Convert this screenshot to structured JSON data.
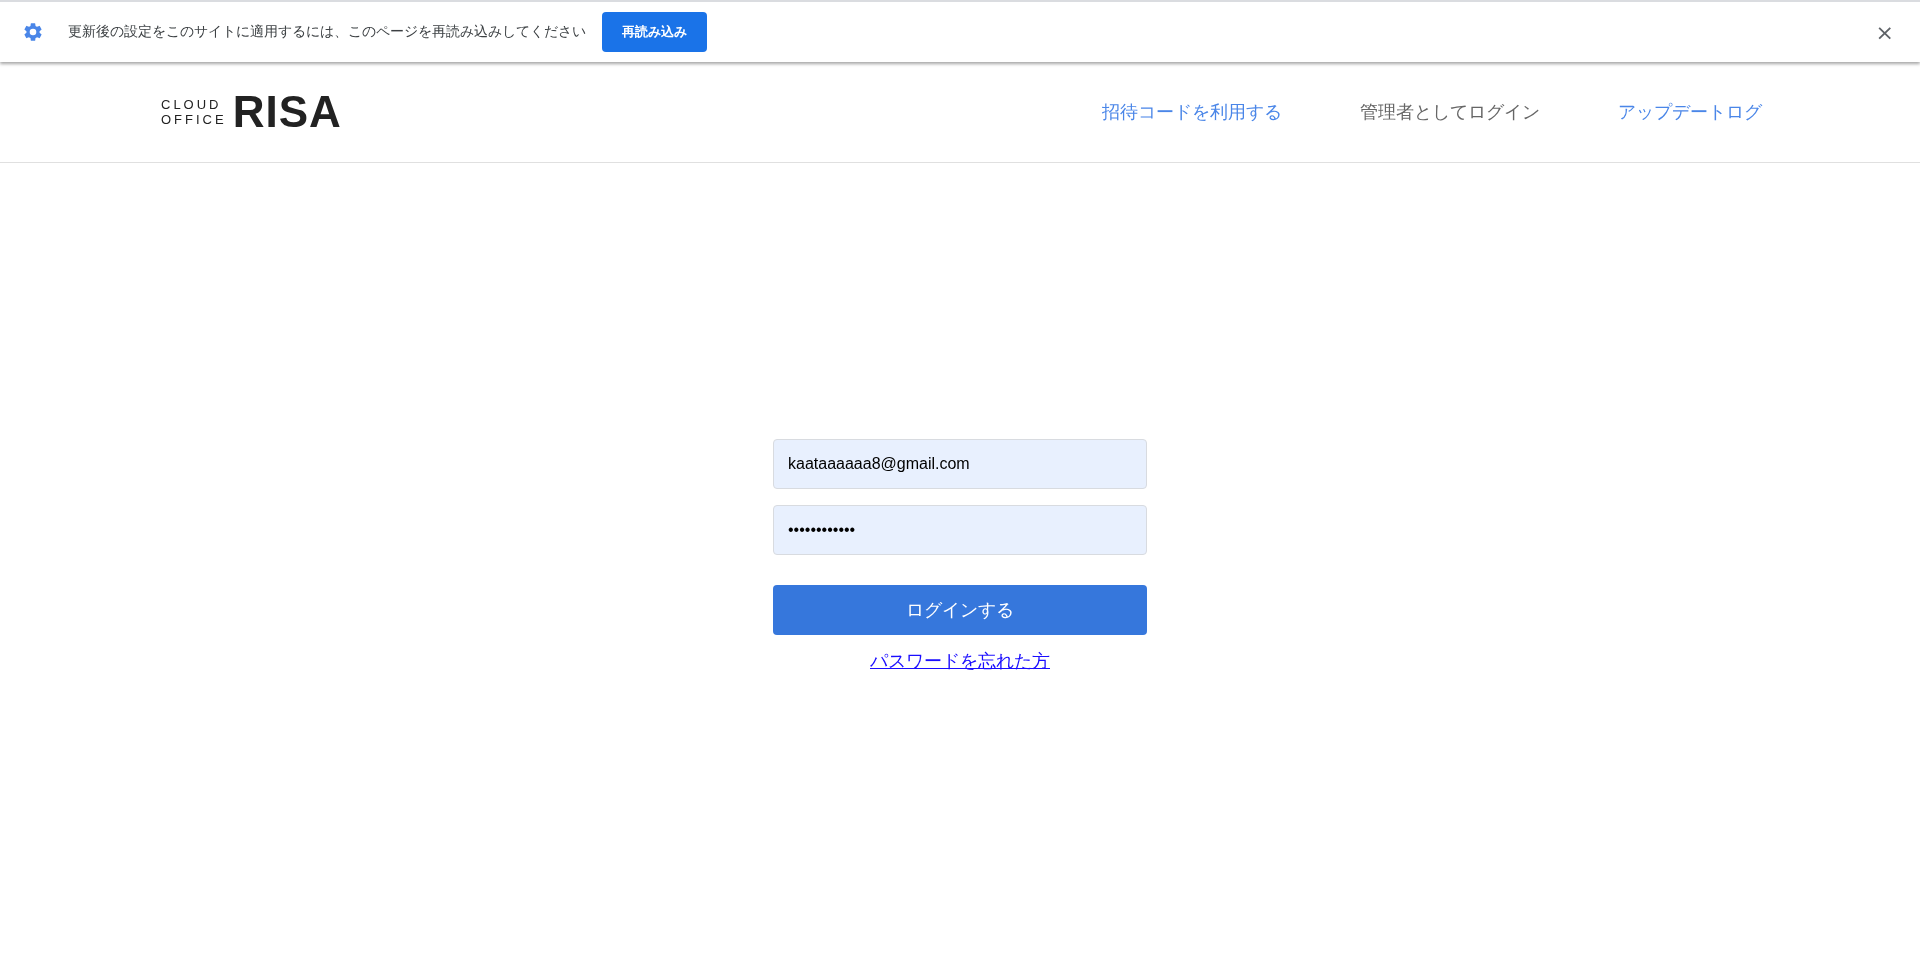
{
  "infobar": {
    "message": "更新後の設定をこのサイトに適用するには、このページを再読み込みしてください",
    "button": "再読み込み",
    "close": "×"
  },
  "header": {
    "logo": {
      "small_top": "CLOUD",
      "small_bottom": "OFFICE",
      "big": "RISA"
    },
    "nav": [
      {
        "label": "招待コードを利用する",
        "kind": "link"
      },
      {
        "label": "管理者としてログイン",
        "kind": "plain"
      },
      {
        "label": "アップデートログ",
        "kind": "link"
      }
    ]
  },
  "login": {
    "email": {
      "value": "kaataaaaaa8@gmail.com"
    },
    "password": {
      "value": "••••••••••••"
    },
    "submit": "ログインする",
    "forgot": "パスワードを忘れた方"
  }
}
